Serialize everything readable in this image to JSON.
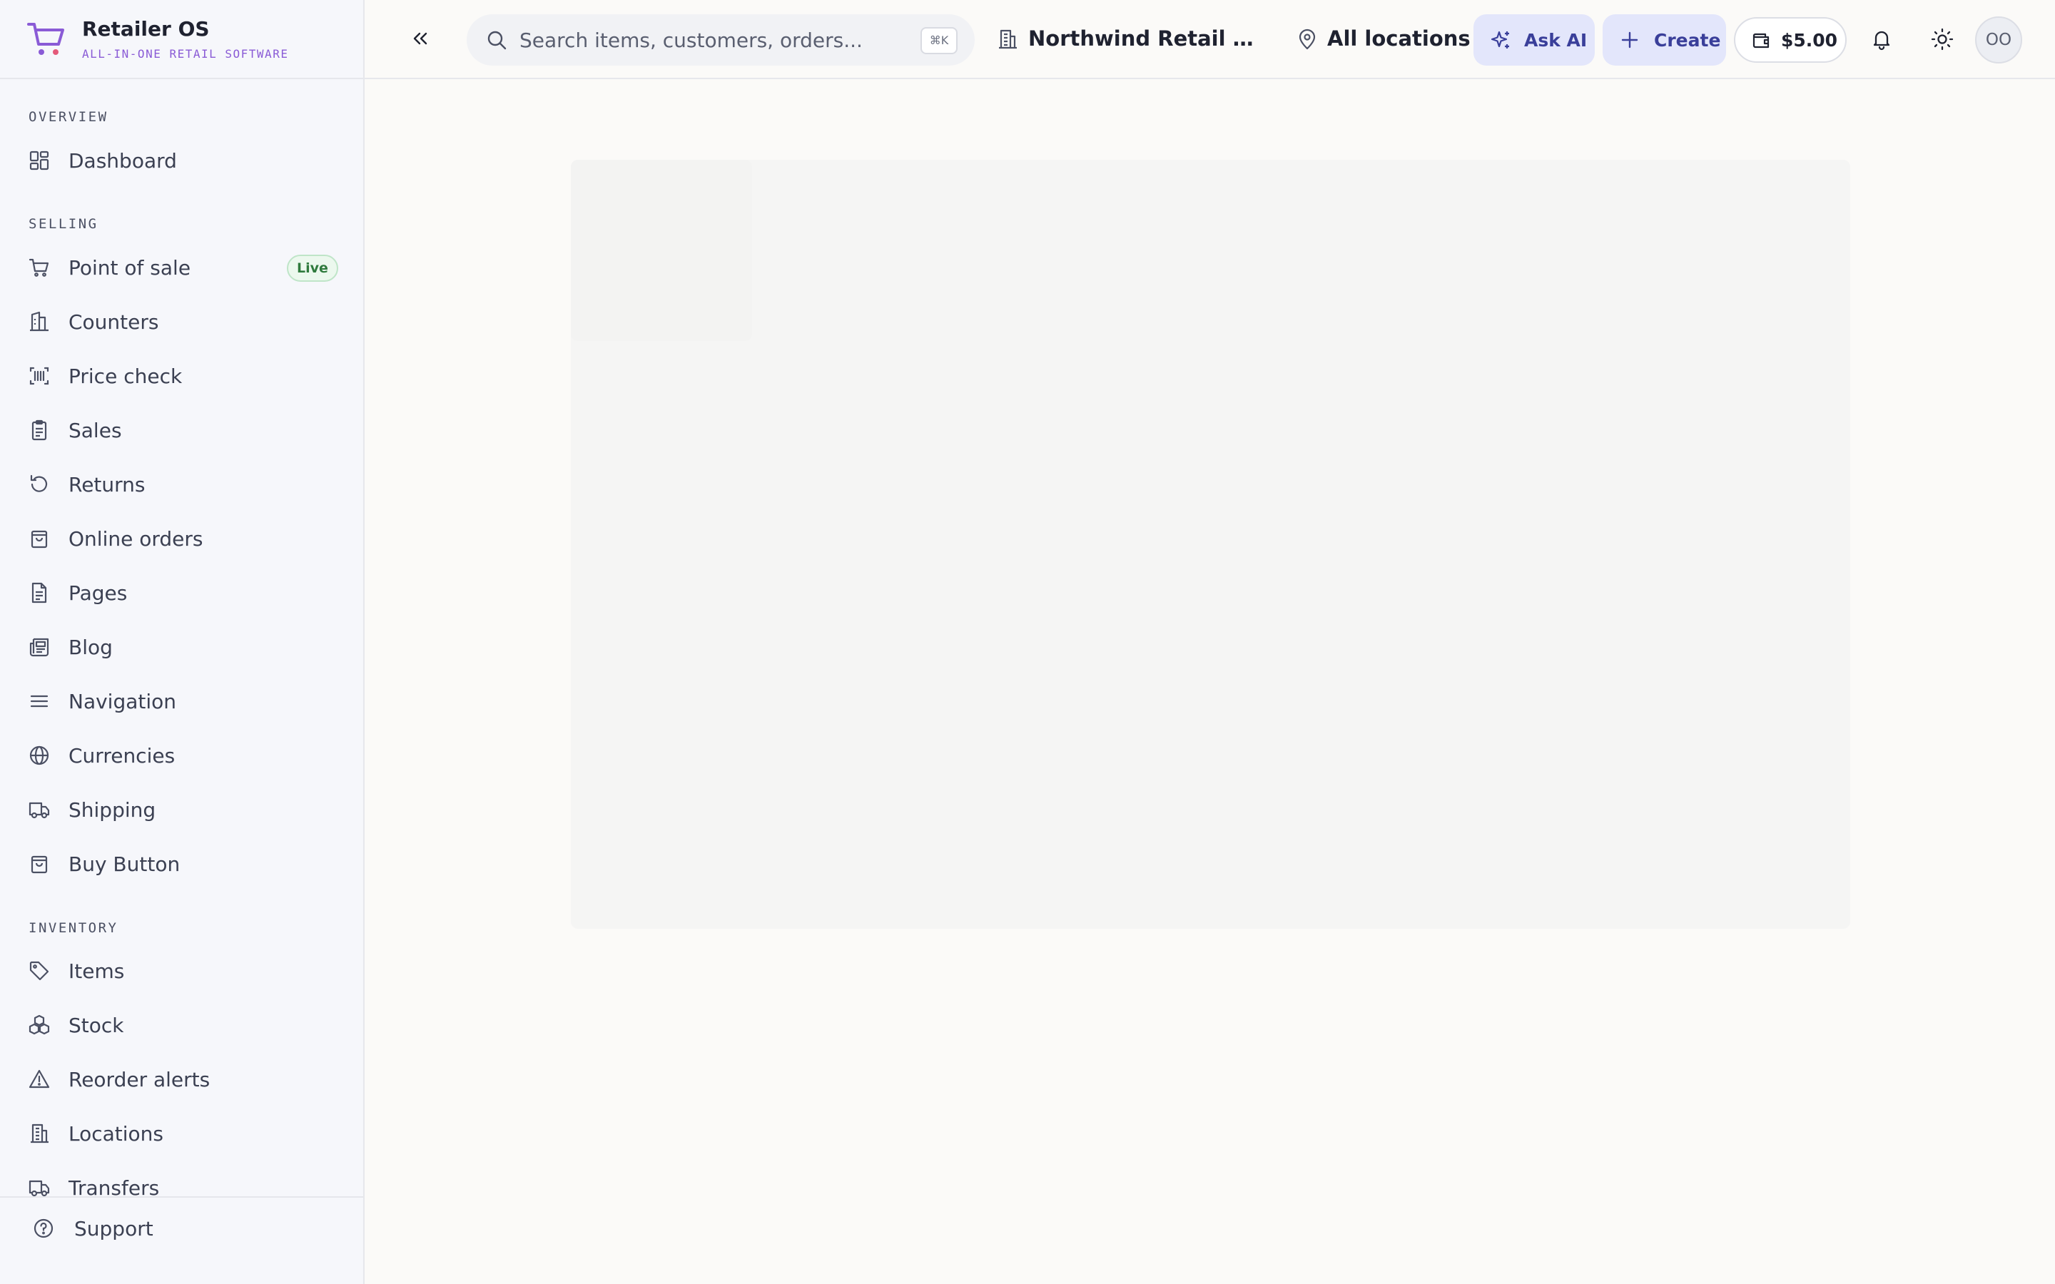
{
  "brand": {
    "name": "Retailer OS",
    "tagline": "ALL-IN-ONE RETAIL SOFTWARE",
    "logo_icon": "shopping-cart-logo",
    "accent_color": "#8a5bd6"
  },
  "sidebar": {
    "sections": [
      {
        "label": "OVERVIEW",
        "items": [
          {
            "label": "Dashboard",
            "icon": "dashboard-icon"
          }
        ]
      },
      {
        "label": "SELLING",
        "items": [
          {
            "label": "Point of sale",
            "icon": "cart-icon",
            "badge": "Live"
          },
          {
            "label": "Counters",
            "icon": "counter-icon"
          },
          {
            "label": "Price check",
            "icon": "barcode-icon"
          },
          {
            "label": "Sales",
            "icon": "clipboard-icon"
          },
          {
            "label": "Returns",
            "icon": "return-icon"
          },
          {
            "label": "Online orders",
            "icon": "shopping-bag-icon"
          },
          {
            "label": "Pages",
            "icon": "file-icon"
          },
          {
            "label": "Blog",
            "icon": "newspaper-icon"
          },
          {
            "label": "Navigation",
            "icon": "menu-icon"
          },
          {
            "label": "Currencies",
            "icon": "globe-icon"
          },
          {
            "label": "Shipping",
            "icon": "truck-icon"
          },
          {
            "label": "Buy Button",
            "icon": "shopping-bag-icon"
          }
        ]
      },
      {
        "label": "INVENTORY",
        "items": [
          {
            "label": "Items",
            "icon": "tag-icon"
          },
          {
            "label": "Stock",
            "icon": "boxes-icon"
          },
          {
            "label": "Reorder alerts",
            "icon": "warning-icon"
          },
          {
            "label": "Locations",
            "icon": "building-icon"
          },
          {
            "label": "Transfers",
            "icon": "truck-icon"
          }
        ]
      }
    ],
    "support_label": "Support"
  },
  "topbar": {
    "search_placeholder": "Search items, customers, orders...",
    "search_shortcut": "⌘K",
    "organization": "Northwind Retail (De...",
    "location": "All locations",
    "ask_ai_label": "Ask AI",
    "create_label": "Create",
    "wallet_balance": "$5.00",
    "avatar_initials": "OO"
  }
}
